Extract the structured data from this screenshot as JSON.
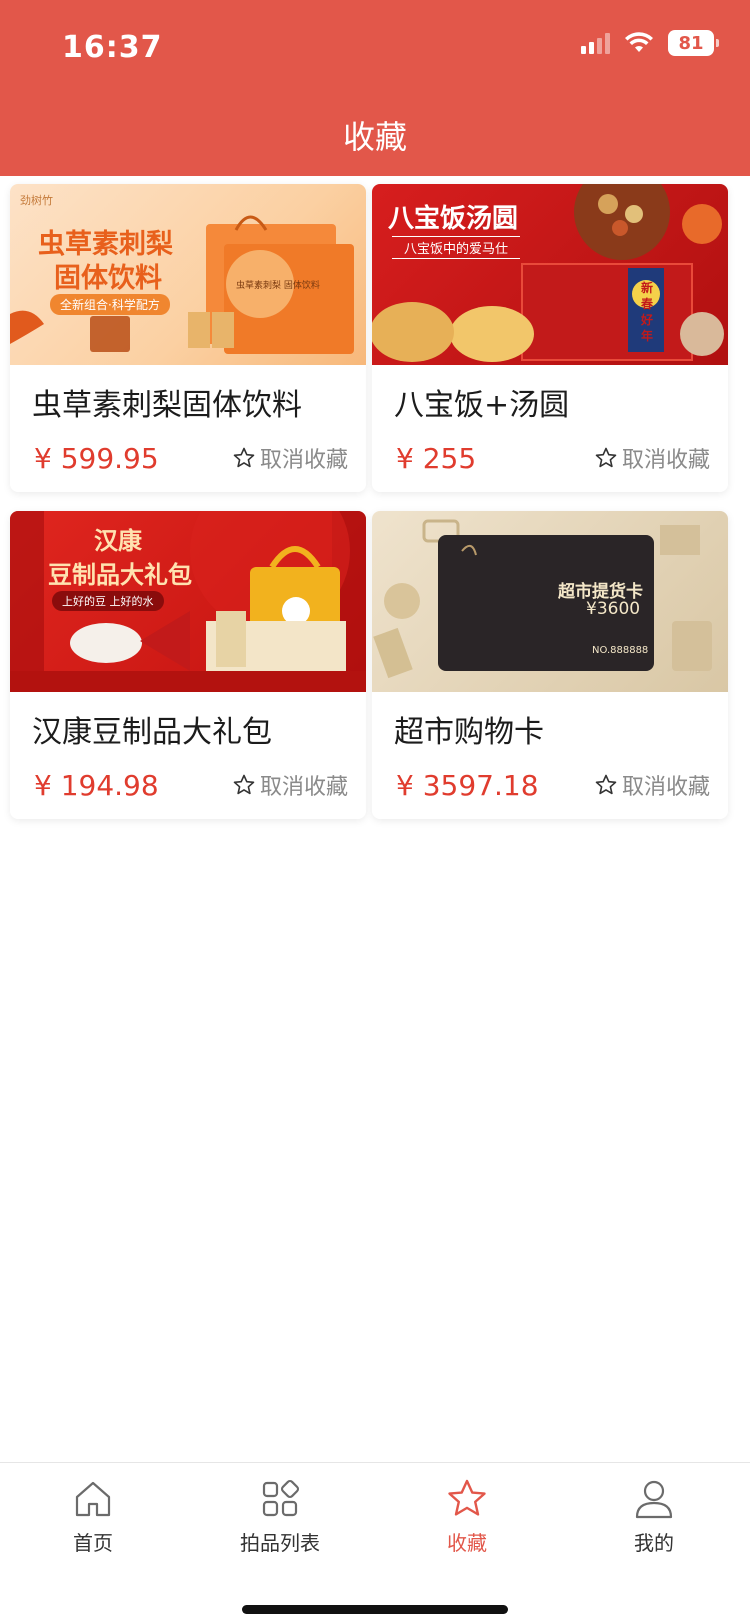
{
  "status_bar": {
    "time": "16:37",
    "battery": "81"
  },
  "header": {
    "title": "收藏"
  },
  "products": [
    {
      "title": "虫草素刺梨固体饮料",
      "price": "¥ 599.95",
      "unfavorite_label": "取消收藏",
      "image_text": {
        "brand": "劲树竹",
        "headline_1": "虫草素刺梨",
        "headline_2": "固体饮料",
        "tagline": "全新组合·科学配方",
        "box_label": "虫草素刺梨 固体饮料"
      }
    },
    {
      "title": "八宝饭+汤圆",
      "price": "¥ 255",
      "unfavorite_label": "取消收藏",
      "image_text": {
        "headline": "八宝饭汤圆",
        "sub": "八宝饭中的爱马仕",
        "badge": "新 春 好 年"
      }
    },
    {
      "title": "汉康豆制品大礼包",
      "price": "¥ 194.98",
      "unfavorite_label": "取消收藏",
      "image_text": {
        "headline_1": "汉康",
        "headline_2": "豆制品大礼包",
        "tagline": "上好的豆 上好的水"
      }
    },
    {
      "title": "超市购物卡",
      "price": "¥ 3597.18",
      "unfavorite_label": "取消收藏",
      "image_text": {
        "card_title": "超市提货卡",
        "card_value": "¥3600",
        "card_no": "NO.888888"
      }
    }
  ],
  "tabbar": {
    "tabs": [
      {
        "label": "首页",
        "icon": "home-icon",
        "active": false
      },
      {
        "label": "拍品列表",
        "icon": "grid-icon",
        "active": false
      },
      {
        "label": "收藏",
        "icon": "star-icon",
        "active": true
      },
      {
        "label": "我的",
        "icon": "user-icon",
        "active": false
      }
    ]
  },
  "colors": {
    "brand": "#e2574a",
    "price": "#e03c2e",
    "muted": "#8a8a8a"
  }
}
